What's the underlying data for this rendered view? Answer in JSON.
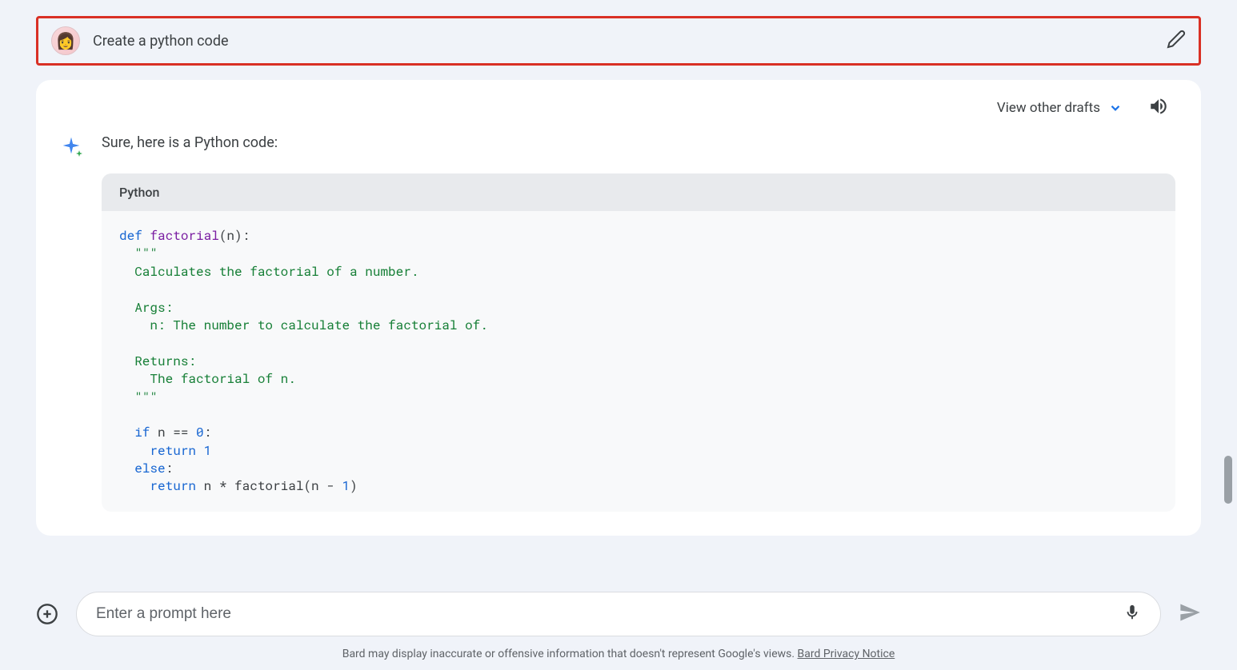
{
  "user_prompt": {
    "text": "Create a python code"
  },
  "response": {
    "view_drafts_label": "View other drafts",
    "intro_text": "Sure, here is a Python code:",
    "code_language": "Python",
    "code_kw_def": "def",
    "code_func_name": " factorial",
    "code_params": "(n):",
    "code_docstring_open": "  \"\"\"",
    "code_doc_line1": "  Calculates the factorial of a number.",
    "code_doc_blank1": "",
    "code_doc_args": "  Args:",
    "code_doc_args_n": "    n: The number to calculate the factorial of.",
    "code_doc_blank2": "",
    "code_doc_returns": "  Returns:",
    "code_doc_returns_val": "    The factorial of n.",
    "code_docstring_close": "  \"\"\"",
    "code_blank3": "",
    "code_if": "  if",
    "code_if_cond": " n == ",
    "code_zero": "0",
    "code_colon1": ":",
    "code_return1": "    return",
    "code_one": " 1",
    "code_else": "  else",
    "code_colon2": ":",
    "code_return2": "    return",
    "code_recursion": " n * factorial(n - ",
    "code_one2": "1",
    "code_close_paren": ")"
  },
  "input": {
    "placeholder": "Enter a prompt here"
  },
  "disclaimer": {
    "text": "Bard may display inaccurate or offensive information that doesn't represent Google's views. ",
    "link_text": "Bard Privacy Notice"
  }
}
